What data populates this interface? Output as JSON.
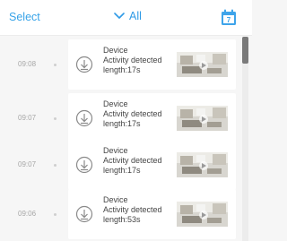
{
  "header": {
    "select_label": "Select",
    "filter_label": "All",
    "calendar_icon": "calendar-icon"
  },
  "events": [
    {
      "time": "09:08",
      "device": "Device",
      "activity": "Activity detected",
      "length": "length:17s"
    },
    {
      "time": "09:07",
      "device": "Device",
      "activity": "Activity detected",
      "length": "length:17s"
    },
    {
      "time": "09:07",
      "device": "Device",
      "activity": "Activity detected",
      "length": "length:17s"
    },
    {
      "time": "09:06",
      "device": "Device",
      "activity": "Activity detected",
      "length": "length:53s"
    }
  ],
  "colors": {
    "accent": "#2e9ae6",
    "background": "#f6f6f6",
    "card": "#ffffff"
  }
}
